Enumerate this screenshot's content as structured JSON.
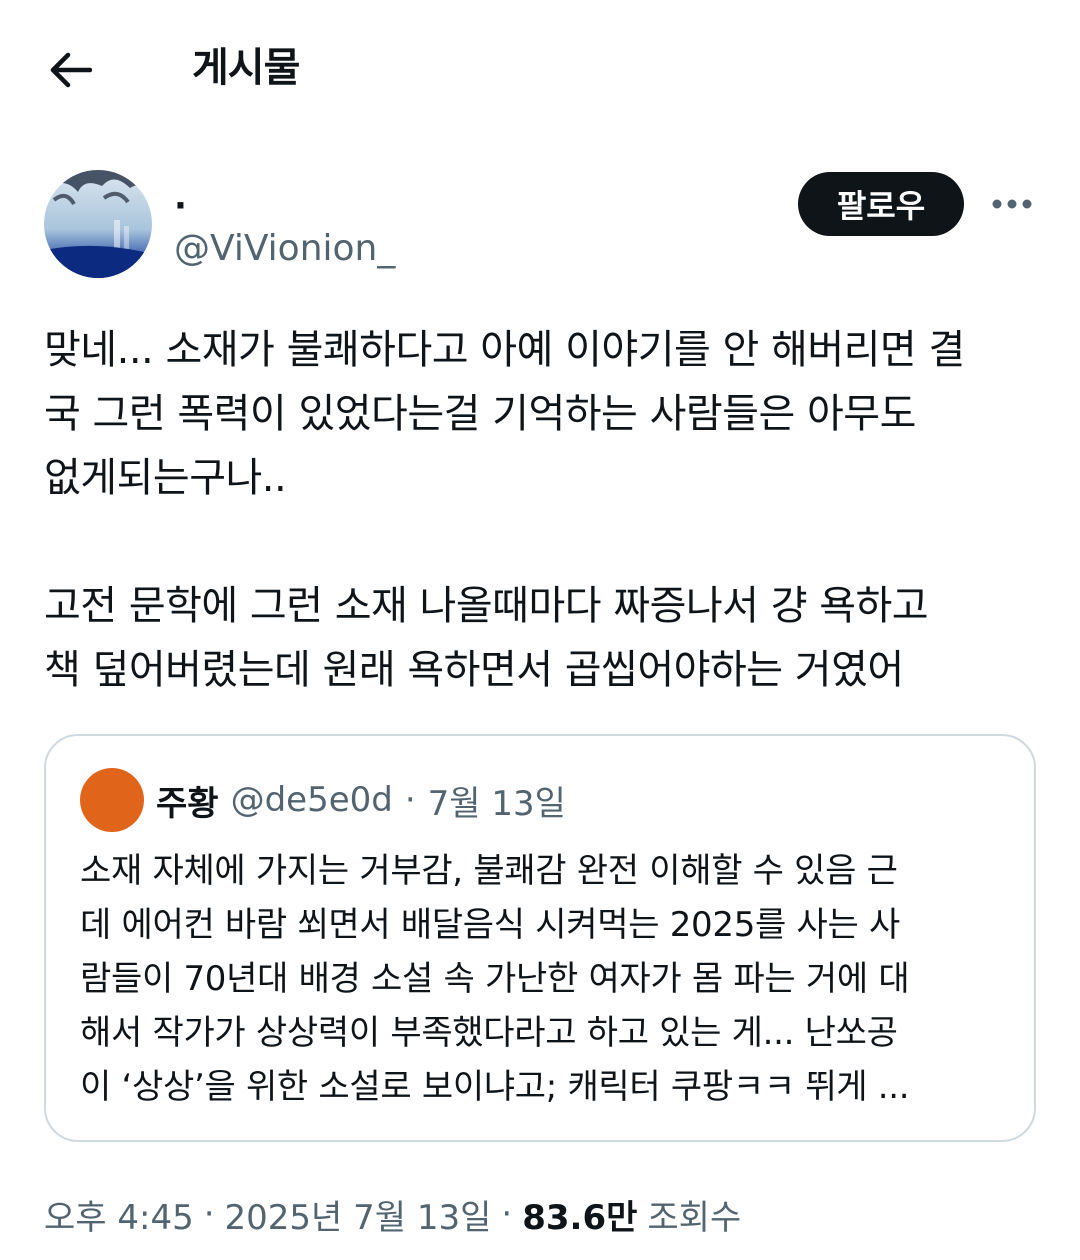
{
  "header": {
    "back_icon": "arrow-left-icon",
    "title": "게시물"
  },
  "author": {
    "display_name": "·",
    "handle": "@ViVionion_",
    "follow_label": "팔로우",
    "more_icon": "more-dots-icon"
  },
  "post": {
    "text": "맞네... 소재가 불쾌하다고 아예 이야기를 안 해버리면 결\n국 그런 폭력이 있었다는걸 기억하는 사람들은 아무도\n없게되는구나..\n\n고전 문학에 그런 소재 나올때마다 짜증나서 걍 욕하고\n책 덮어버렸는데 원래 욕하면서 곱씹어야하는 거였어"
  },
  "quote": {
    "name": "주황",
    "handle": "@de5e0d",
    "separator": "·",
    "date": "7월 13일",
    "avatar_color": "#e0651a",
    "text": "소재 자체에 가지는 거부감, 불쾌감 완전 이해할 수 있음 근\n데 에어컨 바람 쐬면서 배달음식 시켜먹는 2025를 사는 사\n람들이 70년대 배경 소설 속 가난한 여자가 몸 파는 거에 대\n해서 작가가 상상력이 부족했다라고 하고 있는 게... 난쏘공\n이 ‘상상’을 위한 소설로 보이냐고; 캐릭터 쿠팡ㅋㅋ 뛰게 ..."
  },
  "meta": {
    "time": "오후 4:45",
    "sep1": "·",
    "date": "2025년 7월 13일",
    "sep2": "·",
    "views": "83.6만",
    "views_label": "조회수"
  }
}
